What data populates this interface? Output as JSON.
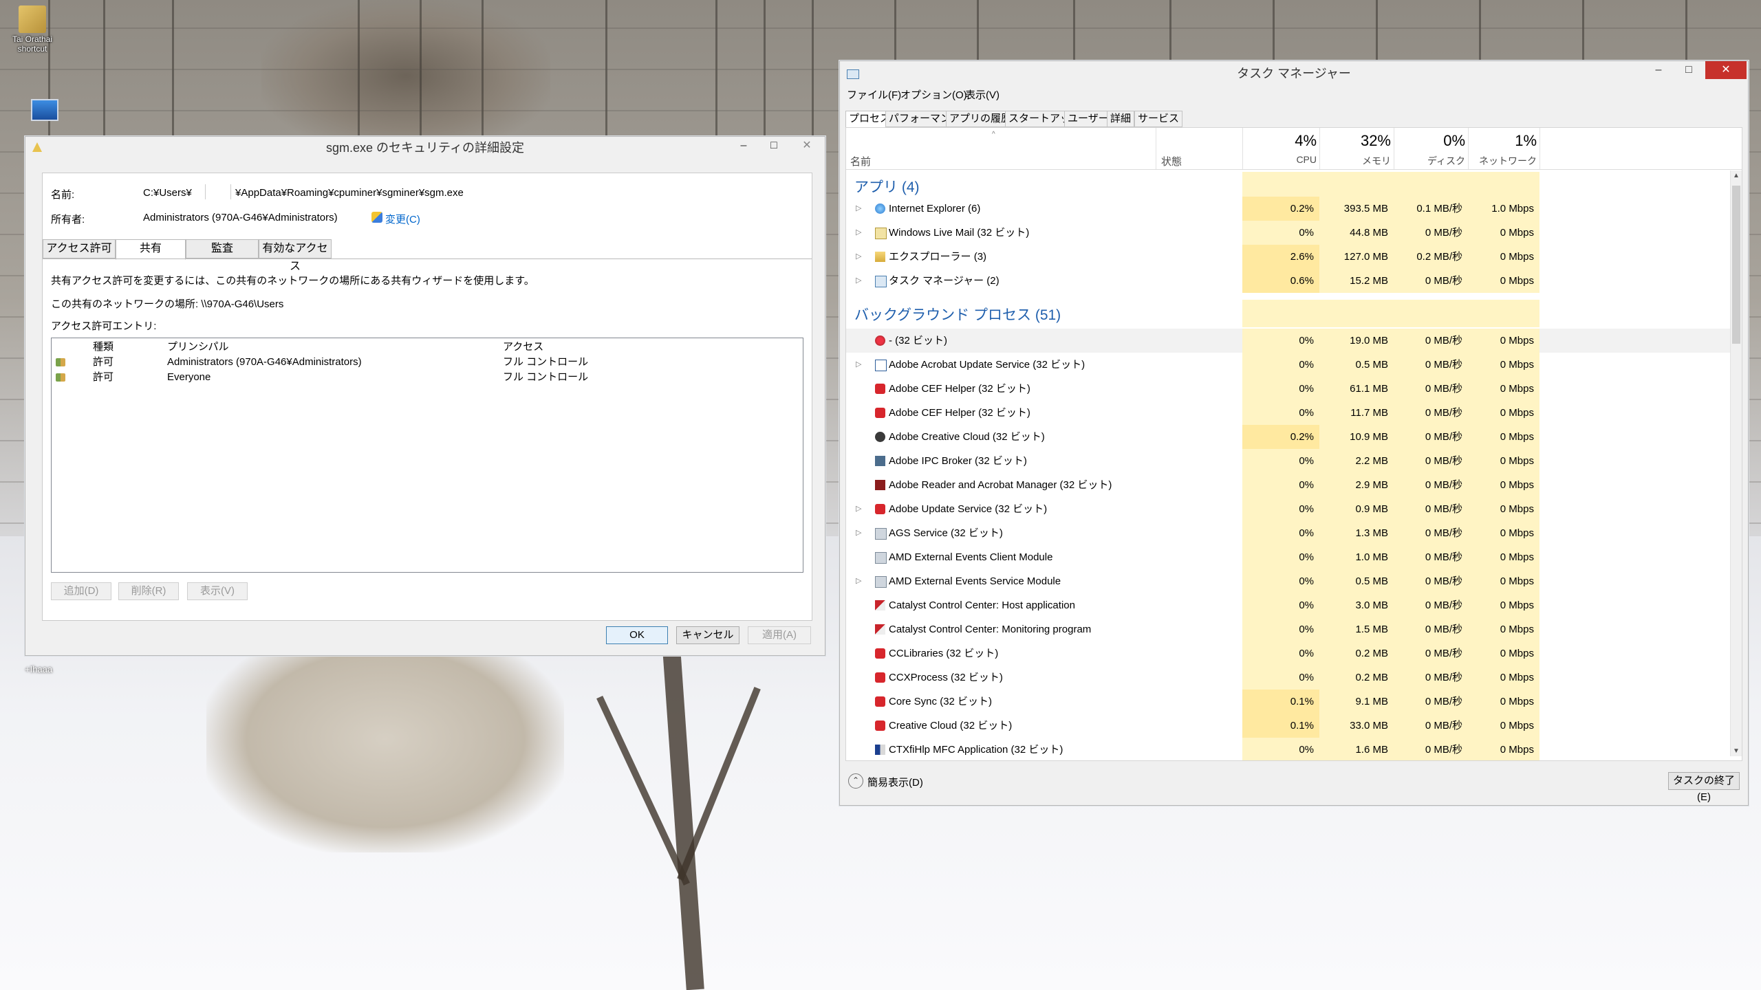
{
  "desktop": {
    "icons": [
      {
        "label": "Tai Orathai\nshortcut",
        "x": 0
      },
      {
        "label": "",
        "x": 0
      }
    ],
    "bottom_label": "+Ihaaa"
  },
  "security_dialog": {
    "title": "sgm.exe のセキュリティの詳細設定",
    "name_label": "名前:",
    "name_value_a": "C:¥Users¥",
    "name_value_b": "¥AppData¥Roaming¥cpuminer¥sgminer¥sgm.exe",
    "owner_label": "所有者:",
    "owner_value": "Administrators (970A-G46¥Administrators)",
    "change_link": "変更(C)",
    "tabs": [
      "アクセス許可",
      "共有",
      "監査",
      "有効なアクセス"
    ],
    "active_tab": 1,
    "share_info": "共有アクセス許可を変更するには、この共有のネットワークの場所にある共有ウィザードを使用します。",
    "share_location": "この共有のネットワークの場所: \\\\970A-G46\\Users",
    "entries_label": "アクセス許可エントリ:",
    "columns": [
      "種類",
      "プリンシパル",
      "アクセス"
    ],
    "entries": [
      {
        "type": "許可",
        "principal": "Administrators (970A-G46¥Administrators)",
        "access": "フル コントロール"
      },
      {
        "type": "許可",
        "principal": "Everyone",
        "access": "フル コントロール"
      }
    ],
    "add_button": "追加(D)",
    "remove_button": "削除(R)",
    "view_button": "表示(V)",
    "ok_button": "OK",
    "cancel_button": "キャンセル",
    "apply_button": "適用(A)"
  },
  "task_manager": {
    "title": "タスク マネージャー",
    "menu": [
      "ファイル(F)",
      "オプション(O)",
      "表示(V)"
    ],
    "tabs": [
      "プロセス",
      "パフォーマンス",
      "アプリの履歴",
      "スタートアップ",
      "ユーザー",
      "詳細",
      "サービス"
    ],
    "active_tab": 0,
    "columns": {
      "name": "名前",
      "status": "状態",
      "cpu": {
        "pct": "4%",
        "label": "CPU"
      },
      "mem": {
        "pct": "32%",
        "label": "メモリ"
      },
      "disk": {
        "pct": "0%",
        "label": "ディスク"
      },
      "net": {
        "pct": "1%",
        "label": "ネットワーク"
      }
    },
    "apps_group": "アプリ (4)",
    "apps": [
      {
        "name": "Internet Explorer (6)",
        "cpu": "0.2%",
        "mem": "393.5 MB",
        "disk": "0.1 MB/秒",
        "net": "1.0 Mbps",
        "icon": "ie-icon",
        "arrow": true
      },
      {
        "name": "Windows Live Mail (32 ビット)",
        "cpu": "0%",
        "mem": "44.8 MB",
        "disk": "0 MB/秒",
        "net": "0 Mbps",
        "icon": "mail-icon",
        "arrow": true
      },
      {
        "name": "エクスプローラー (3)",
        "cpu": "2.6%",
        "mem": "127.0 MB",
        "disk": "0.2 MB/秒",
        "net": "0 Mbps",
        "icon": "folder-icon",
        "arrow": true
      },
      {
        "name": "タスク マネージャー (2)",
        "cpu": "0.6%",
        "mem": "15.2 MB",
        "disk": "0 MB/秒",
        "net": "0 Mbps",
        "icon": "taskmgr-icon",
        "arrow": true
      }
    ],
    "bg_group": "バックグラウンド プロセス (51)",
    "bg": [
      {
        "name": "- (32 ビット)",
        "cpu": "0%",
        "mem": "19.0 MB",
        "disk": "0 MB/秒",
        "net": "0 Mbps",
        "icon": "red-app-icon",
        "arrow": false,
        "selected": true
      },
      {
        "name": "Adobe Acrobat Update Service (32 ビット)",
        "cpu": "0%",
        "mem": "0.5 MB",
        "disk": "0 MB/秒",
        "net": "0 Mbps",
        "icon": "window-icon",
        "arrow": true
      },
      {
        "name": "Adobe CEF Helper (32 ビット)",
        "cpu": "0%",
        "mem": "61.1 MB",
        "disk": "0 MB/秒",
        "net": "0 Mbps",
        "icon": "adobe-cc-icon",
        "arrow": false
      },
      {
        "name": "Adobe CEF Helper (32 ビット)",
        "cpu": "0%",
        "mem": "11.7 MB",
        "disk": "0 MB/秒",
        "net": "0 Mbps",
        "icon": "adobe-cc-icon",
        "arrow": false
      },
      {
        "name": "Adobe Creative Cloud (32 ビット)",
        "cpu": "0.2%",
        "mem": "10.9 MB",
        "disk": "0 MB/秒",
        "net": "0 Mbps",
        "icon": "cloud-icon",
        "arrow": false
      },
      {
        "name": "Adobe IPC Broker (32 ビット)",
        "cpu": "0%",
        "mem": "2.2 MB",
        "disk": "0 MB/秒",
        "net": "0 Mbps",
        "icon": "ipc-icon",
        "arrow": false
      },
      {
        "name": "Adobe Reader and Acrobat Manager (32 ビット)",
        "cpu": "0%",
        "mem": "2.9 MB",
        "disk": "0 MB/秒",
        "net": "0 Mbps",
        "icon": "acrobat-icon",
        "arrow": false
      },
      {
        "name": "Adobe Update Service (32 ビット)",
        "cpu": "0%",
        "mem": "0.9 MB",
        "disk": "0 MB/秒",
        "net": "0 Mbps",
        "icon": "adobe-cc-icon",
        "arrow": true
      },
      {
        "name": "AGS Service (32 ビット)",
        "cpu": "0%",
        "mem": "1.3 MB",
        "disk": "0 MB/秒",
        "net": "0 Mbps",
        "icon": "service-icon",
        "arrow": true
      },
      {
        "name": "AMD External Events Client Module",
        "cpu": "0%",
        "mem": "1.0 MB",
        "disk": "0 MB/秒",
        "net": "0 Mbps",
        "icon": "service-icon",
        "arrow": false
      },
      {
        "name": "AMD External Events Service Module",
        "cpu": "0%",
        "mem": "0.5 MB",
        "disk": "0 MB/秒",
        "net": "0 Mbps",
        "icon": "service-icon",
        "arrow": true
      },
      {
        "name": "Catalyst Control Center: Host application",
        "cpu": "0%",
        "mem": "3.0 MB",
        "disk": "0 MB/秒",
        "net": "0 Mbps",
        "icon": "catalyst-icon",
        "arrow": false
      },
      {
        "name": "Catalyst Control Center: Monitoring program",
        "cpu": "0%",
        "mem": "1.5 MB",
        "disk": "0 MB/秒",
        "net": "0 Mbps",
        "icon": "catalyst-icon",
        "arrow": false
      },
      {
        "name": "CCLibraries (32 ビット)",
        "cpu": "0%",
        "mem": "0.2 MB",
        "disk": "0 MB/秒",
        "net": "0 Mbps",
        "icon": "adobe-cc-icon",
        "arrow": false
      },
      {
        "name": "CCXProcess (32 ビット)",
        "cpu": "0%",
        "mem": "0.2 MB",
        "disk": "0 MB/秒",
        "net": "0 Mbps",
        "icon": "adobe-cc-icon",
        "arrow": false
      },
      {
        "name": "Core Sync (32 ビット)",
        "cpu": "0.1%",
        "mem": "9.1 MB",
        "disk": "0 MB/秒",
        "net": "0 Mbps",
        "icon": "adobe-cc-icon",
        "arrow": false
      },
      {
        "name": "Creative Cloud (32 ビット)",
        "cpu": "0.1%",
        "mem": "33.0 MB",
        "disk": "0 MB/秒",
        "net": "0 Mbps",
        "icon": "adobe-cc-icon",
        "arrow": false
      },
      {
        "name": "CTXfiHlp MFC Application (32 ビット)",
        "cpu": "0%",
        "mem": "1.6 MB",
        "disk": "0 MB/秒",
        "net": "0 Mbps",
        "icon": "ctx-icon",
        "arrow": false
      }
    ],
    "fewer_details": "簡易表示(D)",
    "end_task": "タスクの終了(E)"
  },
  "colors": {
    "heat_low": "#fff4c4",
    "heat_mid": "#ffe9a0",
    "group_blue": "#1f5fad",
    "close_red": "#c7312b"
  }
}
